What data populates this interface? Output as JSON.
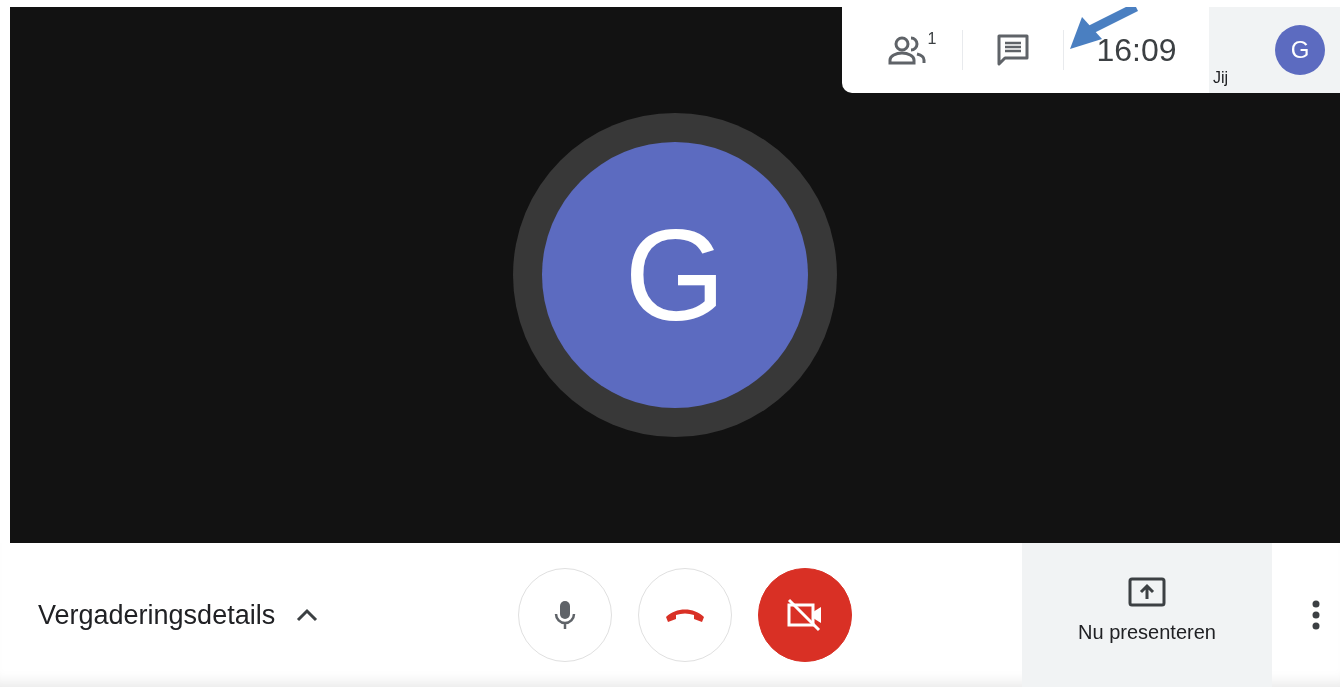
{
  "top_bar": {
    "participants_count": "1",
    "time": "16:09",
    "self_label": "Jij",
    "self_initial": "G"
  },
  "main_avatar": {
    "initial": "G"
  },
  "bottom_bar": {
    "meeting_details": "Vergaderingsdetails",
    "details_expanded": false,
    "mic_muted": false,
    "camera_off": true,
    "present_label": "Nu presenteren"
  }
}
